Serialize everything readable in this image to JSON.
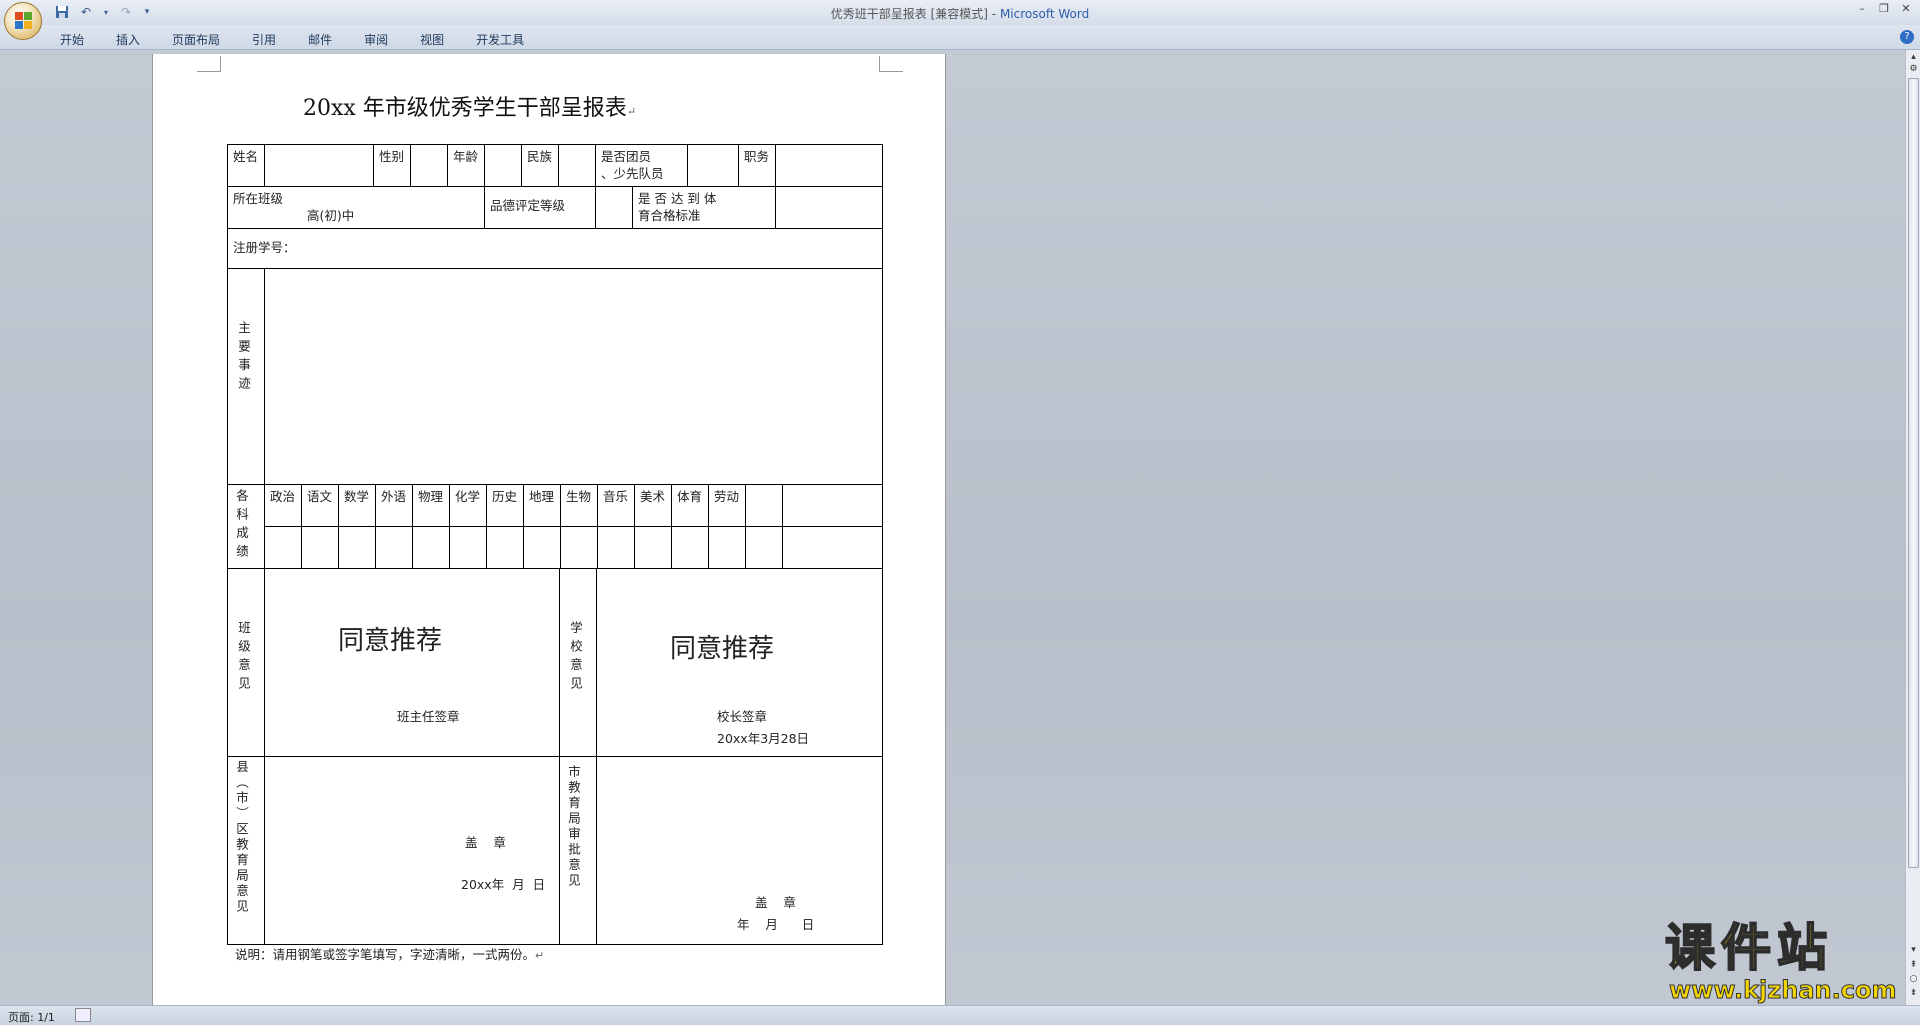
{
  "window": {
    "title": "优秀班干部呈报表 [兼容模式]",
    "app_name": "Microsoft Word",
    "separator": " - "
  },
  "qat": {
    "save_icon": "save-icon",
    "undo_icon": "undo-icon",
    "redo_icon": "redo-icon",
    "more_icon": "customize-qat-icon"
  },
  "ribbon": {
    "tabs": [
      "开始",
      "插入",
      "页面布局",
      "引用",
      "邮件",
      "审阅",
      "视图",
      "开发工具"
    ]
  },
  "document": {
    "title": "20xx 年市级优秀学生干部呈报表",
    "row1": {
      "name_label": "姓名",
      "gender_label": "性别",
      "age_label": "年龄",
      "ethnic_label": "民族",
      "member_label_1": "是否团员",
      "member_label_2": "、少先队员",
      "position_label": "职务"
    },
    "row2": {
      "class_label": "所在班级",
      "class_value": "高(初)中",
      "moral_label": "品德评定等级",
      "pe_label_1": "是 否 达 到 体",
      "pe_label_2": "育合格标准"
    },
    "row3": {
      "reg_label": "注册学号："
    },
    "achievements_label": "主要事迹",
    "grades_label": "各科成绩",
    "subjects": [
      "政治",
      "语文",
      "数学",
      "外语",
      "物理",
      "化学",
      "历史",
      "地理",
      "生物",
      "音乐",
      "美术",
      "体育",
      "劳动"
    ],
    "class_opinion": {
      "label": "班级意见",
      "text": "同意推荐",
      "sign": "班主任签章"
    },
    "school_opinion": {
      "label": "学校意见",
      "text": "同意推荐",
      "sign": "校长签章",
      "date": "20xx年3月28日"
    },
    "county_opinion": {
      "label": "县（市）区教育局意见",
      "seal": "盖    章",
      "date": "20xx年  月  日"
    },
    "city_opinion": {
      "label": "市教育局审批意见",
      "seal": "盖    章",
      "date": "年    月      日"
    },
    "note": "说明：请用钢笔或签字笔填写，字迹清晰，一式两份。",
    "para_mark": "↵"
  },
  "status": {
    "page": "页面: 1/1"
  },
  "watermark": {
    "main": "课件站",
    "url": "www.kjzhan.com"
  }
}
